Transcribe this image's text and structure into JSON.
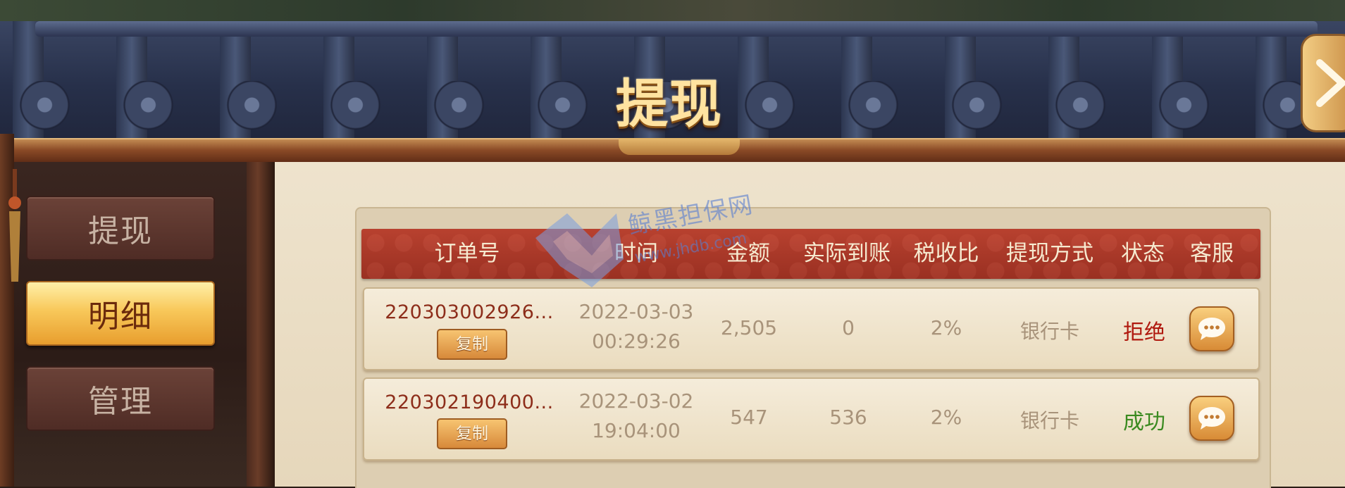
{
  "header": {
    "title": "提现"
  },
  "sidebar": {
    "items": [
      {
        "label": "提现",
        "active": false
      },
      {
        "label": "明细",
        "active": true
      },
      {
        "label": "管理",
        "active": false
      }
    ]
  },
  "table": {
    "columns": [
      "订单号",
      "时间",
      "金额",
      "实际到账",
      "税收比",
      "提现方式",
      "状态",
      "客服"
    ],
    "rows": [
      {
        "order_no": "220303002926...",
        "copy_label": "复制",
        "date": "2022-03-03",
        "time": "00:29:26",
        "amount": "2,505",
        "received": "0",
        "tax": "2%",
        "method": "银行卡",
        "status": "拒绝"
      },
      {
        "order_no": "220302190400...",
        "copy_label": "复制",
        "date": "2022-03-02",
        "time": "19:04:00",
        "amount": "547",
        "received": "536",
        "tax": "2%",
        "method": "银行卡",
        "status": "成功"
      }
    ]
  },
  "watermark": {
    "text": "鲸黑担保网",
    "url": "www.jhdb.com"
  },
  "colors": {
    "status_rejected": "#b0190e",
    "status_success": "#3a8a20",
    "header_red": "#9a3022",
    "active_gold": "#f8c85a"
  },
  "icons": {
    "close": "chevron-right-icon",
    "service": "chat-bubble-icon"
  }
}
